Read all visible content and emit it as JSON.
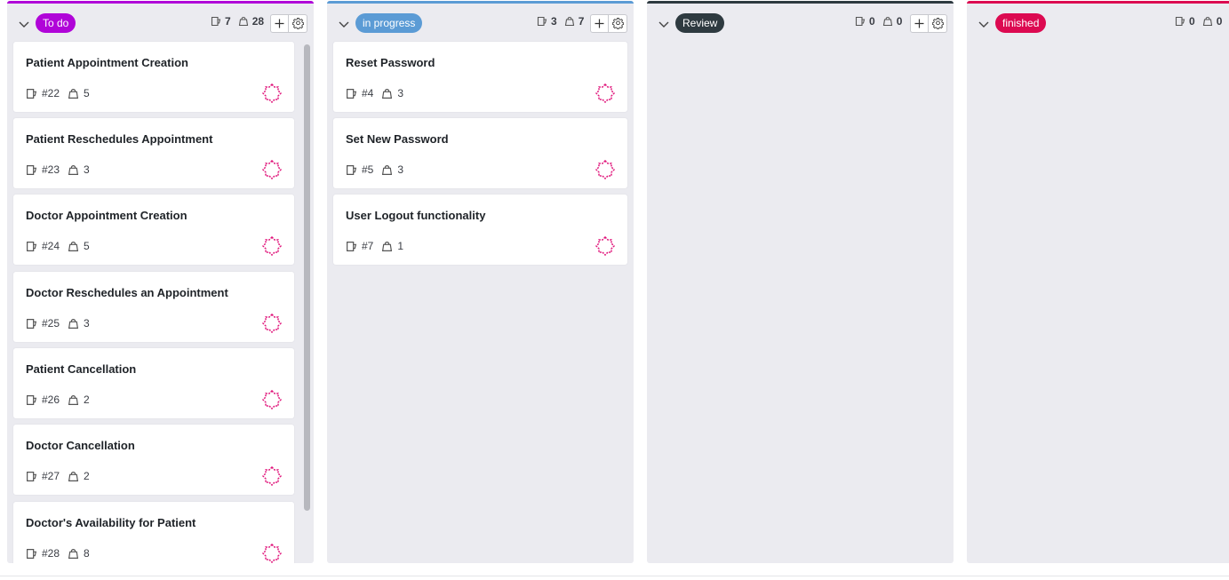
{
  "colors": {
    "todo": "#b005d8",
    "in_progress": "#5b9bd5",
    "review": "#2e3a40",
    "finished": "#dc0a51",
    "avatar": "#e0147a"
  },
  "columns": [
    {
      "key": "todo",
      "label": "To do",
      "stories_count": "7",
      "points_count": "28",
      "cards": [
        {
          "title": "Patient Appointment Creation",
          "ref": "#22",
          "points": "5"
        },
        {
          "title": "Patient Reschedules Appointment",
          "ref": "#23",
          "points": "3"
        },
        {
          "title": "Doctor Appointment Creation",
          "ref": "#24",
          "points": "5"
        },
        {
          "title": "Doctor Reschedules an Appointment",
          "ref": "#25",
          "points": "3"
        },
        {
          "title": "Patient Cancellation",
          "ref": "#26",
          "points": "2"
        },
        {
          "title": "Doctor Cancellation",
          "ref": "#27",
          "points": "2"
        },
        {
          "title": "Doctor's Availability for Patient",
          "ref": "#28",
          "points": "8"
        }
      ]
    },
    {
      "key": "in_progress",
      "label": "in progress",
      "stories_count": "3",
      "points_count": "7",
      "cards": [
        {
          "title": "Reset Password",
          "ref": "#4",
          "points": "3"
        },
        {
          "title": "Set New Password",
          "ref": "#5",
          "points": "3"
        },
        {
          "title": "User Logout functionality",
          "ref": "#7",
          "points": "1"
        }
      ]
    },
    {
      "key": "review",
      "label": "Review",
      "stories_count": "0",
      "points_count": "0",
      "cards": []
    },
    {
      "key": "finished",
      "label": "finished",
      "stories_count": "0",
      "points_count": "0",
      "cards": []
    }
  ],
  "icons": {
    "collapse": "chevron-down-icon",
    "stories": "user-story-icon",
    "points": "weight-icon",
    "add": "plus-icon",
    "settings": "gear-icon",
    "assignee": "avatar-icon"
  }
}
